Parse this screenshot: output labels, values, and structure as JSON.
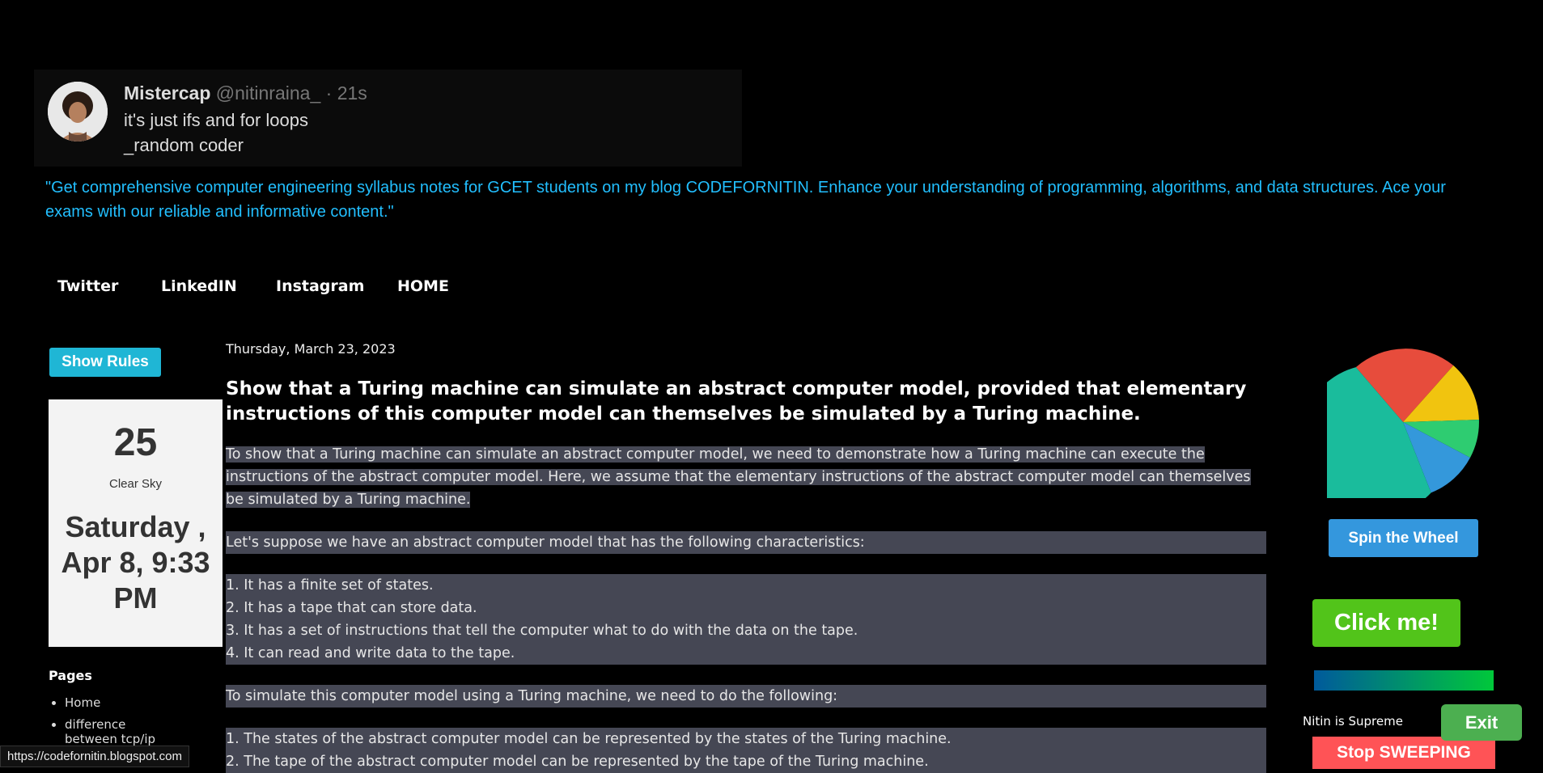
{
  "tweet": {
    "name": "Mistercap",
    "handle": "@nitinraina_",
    "time": "· 21s",
    "line1": "it's just ifs and  for loops",
    "line2": "_random coder"
  },
  "tagline": "\"Get comprehensive computer engineering syllabus notes for GCET students on my blog CODEFORNITIN. Enhance your understanding of programming, algorithms, and data structures. Ace your exams with our reliable and informative content.\"",
  "nav": [
    "Twitter",
    "LinkedIN",
    "Instagram",
    "HOME"
  ],
  "sidebar": {
    "show_rules": "Show Rules",
    "weather": {
      "temp": "25",
      "condition": "Clear Sky",
      "datetime": "Saturday , Apr 8, 9:33 PM"
    },
    "pages_title": "Pages",
    "pages": [
      "Home",
      "difference between tcp/ip"
    ]
  },
  "post": {
    "date": "Thursday, March 23, 2023",
    "title": "Show that a Turing machine can simulate an abstract computer model, provided that elementary instructions of this computer model can themselves be simulated by a Turing machine.",
    "intro": " To show that a Turing machine can simulate an abstract computer model, we need to demonstrate how a Turing machine can execute the instructions of the abstract computer model. Here, we assume that the elementary instructions of the abstract computer model can themselves be simulated by a Turing machine.",
    "para2": "Let's suppose we have an abstract computer model that has the following characteristics:",
    "list1": [
      "1.  It has a finite set of states.",
      "2.  It has a tape that can store data.",
      "3.  It has a set of instructions that tell the computer what to do with the data on the tape.",
      "4.  It can read and write data to the tape."
    ],
    "para3": "To simulate this computer model using a Turing machine, we need to do the following:",
    "list2": [
      "1.  The states of the abstract computer model can be represented by the states of the Turing machine.",
      "2.  The tape of the abstract computer model can be represented by the tape of the Turing machine."
    ]
  },
  "right": {
    "spin_label": "Spin the Wheel",
    "click_label": "Click me!",
    "supreme": "Nitin is Supreme",
    "exit_label": "Exit",
    "stop_label": "Stop SWEEPING"
  },
  "status_url": "https://codefornitin.blogspot.com",
  "colors": {
    "tagline": "#22bfff",
    "highlight": "#454754",
    "wheel": [
      "#e74c3c",
      "#f1c40f",
      "#2ecc71",
      "#3498db",
      "#1abc9c"
    ]
  }
}
